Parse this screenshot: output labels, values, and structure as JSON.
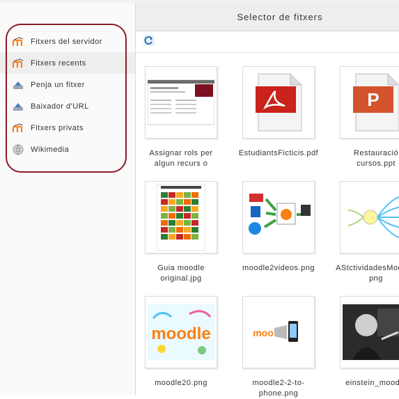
{
  "title": "Selector de fitxers",
  "colors": {
    "highlight_border": "#8b1a2a",
    "moodle_orange": "#f98012",
    "selected_bg": "#eeeeee"
  },
  "sidebar": {
    "items": [
      {
        "label": "Fitxers del servidor",
        "icon": "moodle-icon",
        "selected": false
      },
      {
        "label": "Fitxers recents",
        "icon": "moodle-icon",
        "selected": true
      },
      {
        "label": "Penja un fitxer",
        "icon": "upload-icon",
        "selected": false
      },
      {
        "label": "Baixador d'URL",
        "icon": "url-download-icon",
        "selected": false
      },
      {
        "label": "Fitxers privats",
        "icon": "moodle-icon",
        "selected": false
      },
      {
        "label": "Wikimedia",
        "icon": "wikimedia-icon",
        "selected": false
      }
    ]
  },
  "toolbar": {
    "refresh_icon": "refresh-icon"
  },
  "files": [
    {
      "name": "Assignar rols per algun recurs o",
      "thumb": "screenshot-thumbnail"
    },
    {
      "name": "EstudiantsFicticis.pdf",
      "thumb": "pdf-file-icon"
    },
    {
      "name": "Restauració cursos.ppt",
      "thumb": "ppt-file-icon"
    },
    {
      "name": "Guia moodle original.jpg",
      "thumb": "color-grid-thumbnail"
    },
    {
      "name": "moodle2videos.png",
      "thumb": "moodle-video-diagram-thumbnail"
    },
    {
      "name": "AStctividadesMoodle.png",
      "thumb": "mindmap-thumbnail"
    },
    {
      "name": "moodle20.png",
      "thumb": "moodle-logo-art-thumbnail"
    },
    {
      "name": "moodle2-2-to-phone.png",
      "thumb": "moodle-to-phone-thumbnail"
    },
    {
      "name": "einstein_moodle",
      "thumb": "einstein-photo-thumbnail"
    }
  ]
}
